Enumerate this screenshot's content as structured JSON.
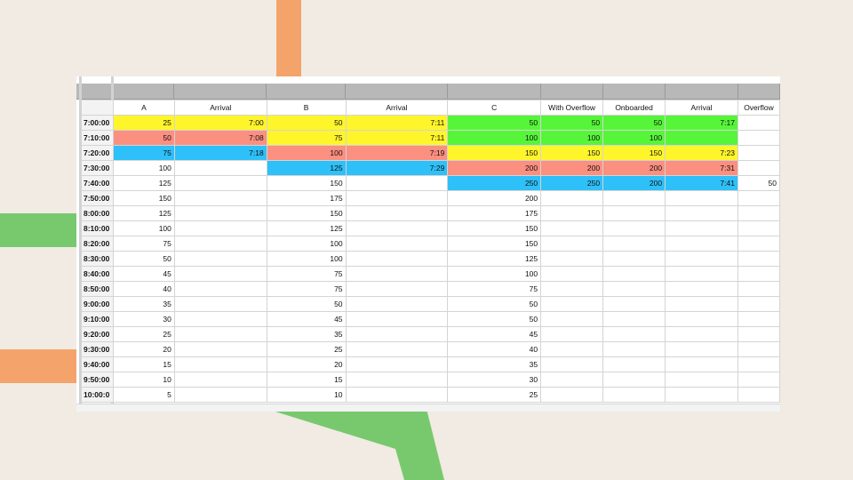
{
  "colors": {
    "background": "#f1ebe4",
    "accent_orange": "#f4a46a",
    "accent_green": "#78c96e",
    "yellow": "#fff52b",
    "red": "#fb8f80",
    "blue": "#2ec0f8",
    "green": "#57f53a"
  },
  "sheet": {
    "headers": [
      "",
      "A",
      "Arrival",
      "B",
      "Arrival",
      "C",
      "With Overflow",
      "Onboarded",
      "Arrival",
      "Overflow"
    ],
    "rows": [
      {
        "time": "7:00:00",
        "cells": [
          {
            "v": "25",
            "c": "yellow"
          },
          {
            "v": "7:00",
            "c": "yellow"
          },
          {
            "v": "50",
            "c": "yellow"
          },
          {
            "v": "7:11",
            "c": "yellow"
          },
          {
            "v": "50",
            "c": "green"
          },
          {
            "v": "50",
            "c": "green"
          },
          {
            "v": "50",
            "c": "green"
          },
          {
            "v": "7:17",
            "c": "green"
          },
          {
            "v": "",
            "c": ""
          }
        ]
      },
      {
        "time": "7:10:00",
        "cells": [
          {
            "v": "50",
            "c": "red"
          },
          {
            "v": "7:08",
            "c": "red"
          },
          {
            "v": "75",
            "c": "yellow"
          },
          {
            "v": "7:11",
            "c": "yellow"
          },
          {
            "v": "100",
            "c": "green"
          },
          {
            "v": "100",
            "c": "green"
          },
          {
            "v": "100",
            "c": "green"
          },
          {
            "v": "",
            "c": "green"
          },
          {
            "v": "",
            "c": ""
          }
        ]
      },
      {
        "time": "7:20:00",
        "cells": [
          {
            "v": "75",
            "c": "blue"
          },
          {
            "v": "7:18",
            "c": "blue"
          },
          {
            "v": "100",
            "c": "red"
          },
          {
            "v": "7:19",
            "c": "red"
          },
          {
            "v": "150",
            "c": "yellow"
          },
          {
            "v": "150",
            "c": "yellow"
          },
          {
            "v": "150",
            "c": "yellow"
          },
          {
            "v": "7:23",
            "c": "yellow"
          },
          {
            "v": "",
            "c": ""
          }
        ]
      },
      {
        "time": "7:30:00",
        "cells": [
          {
            "v": "100",
            "c": ""
          },
          {
            "v": "",
            "c": ""
          },
          {
            "v": "125",
            "c": "blue"
          },
          {
            "v": "7:29",
            "c": "blue"
          },
          {
            "v": "200",
            "c": "red"
          },
          {
            "v": "200",
            "c": "red"
          },
          {
            "v": "200",
            "c": "red"
          },
          {
            "v": "7:31",
            "c": "red"
          },
          {
            "v": "",
            "c": ""
          }
        ]
      },
      {
        "time": "7:40:00",
        "cells": [
          {
            "v": "125",
            "c": ""
          },
          {
            "v": "",
            "c": ""
          },
          {
            "v": "150",
            "c": ""
          },
          {
            "v": "",
            "c": ""
          },
          {
            "v": "250",
            "c": "blue"
          },
          {
            "v": "250",
            "c": "blue"
          },
          {
            "v": "200",
            "c": "blue"
          },
          {
            "v": "7:41",
            "c": "blue"
          },
          {
            "v": "50",
            "c": ""
          }
        ]
      },
      {
        "time": "7:50:00",
        "cells": [
          {
            "v": "150",
            "c": ""
          },
          {
            "v": "",
            "c": ""
          },
          {
            "v": "175",
            "c": ""
          },
          {
            "v": "",
            "c": ""
          },
          {
            "v": "200",
            "c": ""
          },
          {
            "v": "",
            "c": ""
          },
          {
            "v": "",
            "c": ""
          },
          {
            "v": "",
            "c": ""
          },
          {
            "v": "",
            "c": ""
          }
        ]
      },
      {
        "time": "8:00:00",
        "cells": [
          {
            "v": "125",
            "c": ""
          },
          {
            "v": "",
            "c": ""
          },
          {
            "v": "150",
            "c": ""
          },
          {
            "v": "",
            "c": ""
          },
          {
            "v": "175",
            "c": ""
          },
          {
            "v": "",
            "c": ""
          },
          {
            "v": "",
            "c": ""
          },
          {
            "v": "",
            "c": ""
          },
          {
            "v": "",
            "c": ""
          }
        ]
      },
      {
        "time": "8:10:00",
        "cells": [
          {
            "v": "100",
            "c": ""
          },
          {
            "v": "",
            "c": ""
          },
          {
            "v": "125",
            "c": ""
          },
          {
            "v": "",
            "c": ""
          },
          {
            "v": "150",
            "c": ""
          },
          {
            "v": "",
            "c": ""
          },
          {
            "v": "",
            "c": ""
          },
          {
            "v": "",
            "c": ""
          },
          {
            "v": "",
            "c": ""
          }
        ]
      },
      {
        "time": "8:20:00",
        "cells": [
          {
            "v": "75",
            "c": ""
          },
          {
            "v": "",
            "c": ""
          },
          {
            "v": "100",
            "c": ""
          },
          {
            "v": "",
            "c": ""
          },
          {
            "v": "150",
            "c": ""
          },
          {
            "v": "",
            "c": ""
          },
          {
            "v": "",
            "c": ""
          },
          {
            "v": "",
            "c": ""
          },
          {
            "v": "",
            "c": ""
          }
        ]
      },
      {
        "time": "8:30:00",
        "cells": [
          {
            "v": "50",
            "c": ""
          },
          {
            "v": "",
            "c": ""
          },
          {
            "v": "100",
            "c": ""
          },
          {
            "v": "",
            "c": ""
          },
          {
            "v": "125",
            "c": ""
          },
          {
            "v": "",
            "c": ""
          },
          {
            "v": "",
            "c": ""
          },
          {
            "v": "",
            "c": ""
          },
          {
            "v": "",
            "c": ""
          }
        ]
      },
      {
        "time": "8:40:00",
        "cells": [
          {
            "v": "45",
            "c": ""
          },
          {
            "v": "",
            "c": ""
          },
          {
            "v": "75",
            "c": ""
          },
          {
            "v": "",
            "c": ""
          },
          {
            "v": "100",
            "c": ""
          },
          {
            "v": "",
            "c": ""
          },
          {
            "v": "",
            "c": ""
          },
          {
            "v": "",
            "c": ""
          },
          {
            "v": "",
            "c": ""
          }
        ]
      },
      {
        "time": "8:50:00",
        "cells": [
          {
            "v": "40",
            "c": ""
          },
          {
            "v": "",
            "c": ""
          },
          {
            "v": "75",
            "c": ""
          },
          {
            "v": "",
            "c": ""
          },
          {
            "v": "75",
            "c": ""
          },
          {
            "v": "",
            "c": ""
          },
          {
            "v": "",
            "c": ""
          },
          {
            "v": "",
            "c": ""
          },
          {
            "v": "",
            "c": ""
          }
        ]
      },
      {
        "time": "9:00:00",
        "cells": [
          {
            "v": "35",
            "c": ""
          },
          {
            "v": "",
            "c": ""
          },
          {
            "v": "50",
            "c": ""
          },
          {
            "v": "",
            "c": ""
          },
          {
            "v": "50",
            "c": ""
          },
          {
            "v": "",
            "c": ""
          },
          {
            "v": "",
            "c": ""
          },
          {
            "v": "",
            "c": ""
          },
          {
            "v": "",
            "c": ""
          }
        ]
      },
      {
        "time": "9:10:00",
        "cells": [
          {
            "v": "30",
            "c": ""
          },
          {
            "v": "",
            "c": ""
          },
          {
            "v": "45",
            "c": ""
          },
          {
            "v": "",
            "c": ""
          },
          {
            "v": "50",
            "c": ""
          },
          {
            "v": "",
            "c": ""
          },
          {
            "v": "",
            "c": ""
          },
          {
            "v": "",
            "c": ""
          },
          {
            "v": "",
            "c": ""
          }
        ]
      },
      {
        "time": "9:20:00",
        "cells": [
          {
            "v": "25",
            "c": ""
          },
          {
            "v": "",
            "c": ""
          },
          {
            "v": "35",
            "c": ""
          },
          {
            "v": "",
            "c": ""
          },
          {
            "v": "45",
            "c": ""
          },
          {
            "v": "",
            "c": ""
          },
          {
            "v": "",
            "c": ""
          },
          {
            "v": "",
            "c": ""
          },
          {
            "v": "",
            "c": ""
          }
        ]
      },
      {
        "time": "9:30:00",
        "cells": [
          {
            "v": "20",
            "c": ""
          },
          {
            "v": "",
            "c": ""
          },
          {
            "v": "25",
            "c": ""
          },
          {
            "v": "",
            "c": ""
          },
          {
            "v": "40",
            "c": ""
          },
          {
            "v": "",
            "c": ""
          },
          {
            "v": "",
            "c": ""
          },
          {
            "v": "",
            "c": ""
          },
          {
            "v": "",
            "c": ""
          }
        ]
      },
      {
        "time": "9:40:00",
        "cells": [
          {
            "v": "15",
            "c": ""
          },
          {
            "v": "",
            "c": ""
          },
          {
            "v": "20",
            "c": ""
          },
          {
            "v": "",
            "c": ""
          },
          {
            "v": "35",
            "c": ""
          },
          {
            "v": "",
            "c": ""
          },
          {
            "v": "",
            "c": ""
          },
          {
            "v": "",
            "c": ""
          },
          {
            "v": "",
            "c": ""
          }
        ]
      },
      {
        "time": "9:50:00",
        "cells": [
          {
            "v": "10",
            "c": ""
          },
          {
            "v": "",
            "c": ""
          },
          {
            "v": "15",
            "c": ""
          },
          {
            "v": "",
            "c": ""
          },
          {
            "v": "30",
            "c": ""
          },
          {
            "v": "",
            "c": ""
          },
          {
            "v": "",
            "c": ""
          },
          {
            "v": "",
            "c": ""
          },
          {
            "v": "",
            "c": ""
          }
        ]
      },
      {
        "time": "10:00:0",
        "cells": [
          {
            "v": "5",
            "c": ""
          },
          {
            "v": "",
            "c": ""
          },
          {
            "v": "10",
            "c": ""
          },
          {
            "v": "",
            "c": ""
          },
          {
            "v": "25",
            "c": ""
          },
          {
            "v": "",
            "c": ""
          },
          {
            "v": "",
            "c": ""
          },
          {
            "v": "",
            "c": ""
          },
          {
            "v": "",
            "c": ""
          }
        ]
      }
    ]
  }
}
